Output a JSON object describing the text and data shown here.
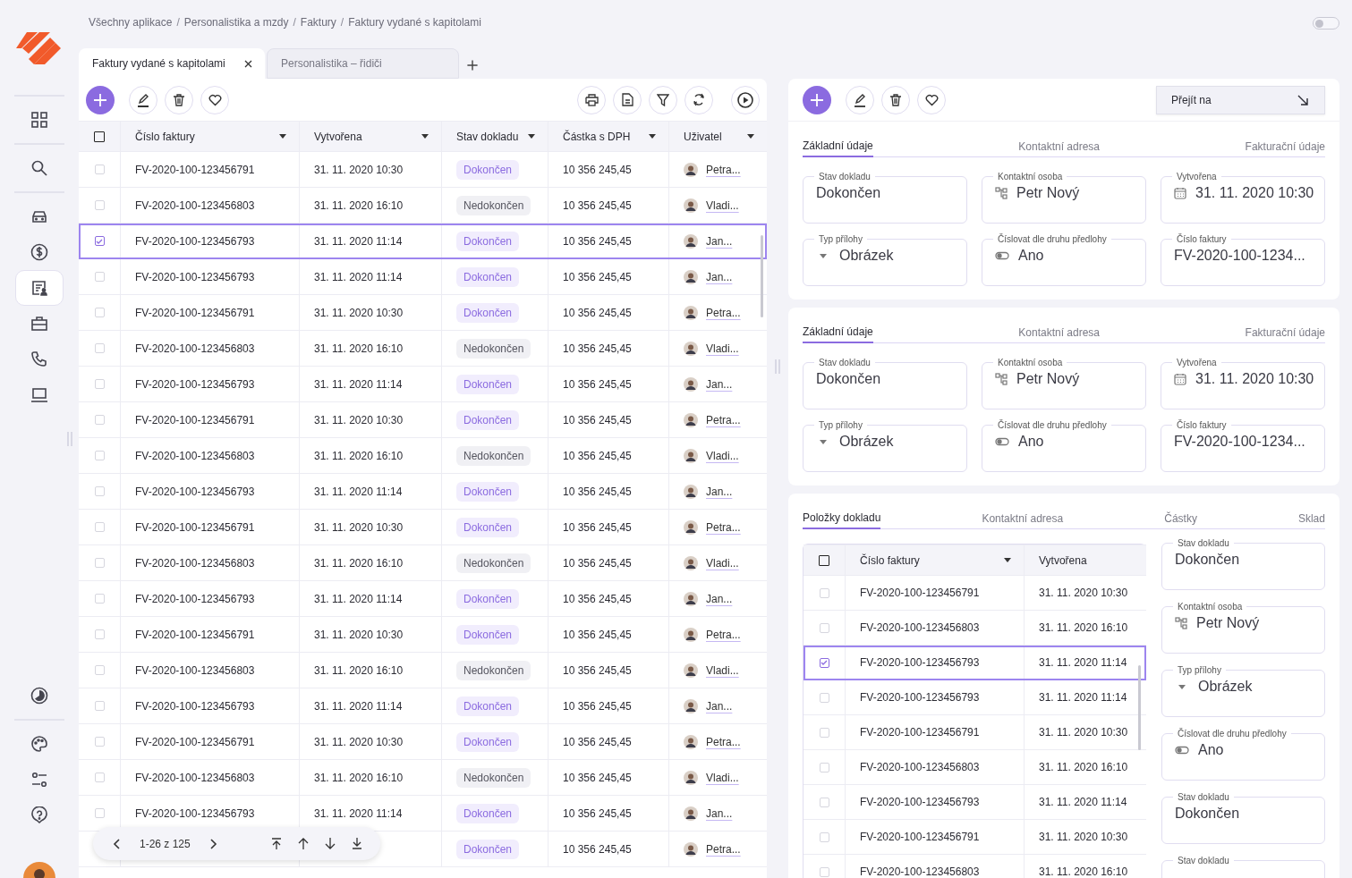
{
  "breadcrumb": [
    "Všechny aplikace",
    "Personalistika a mzdy",
    "Faktury",
    "Faktury vydané s kapitolami"
  ],
  "breadcrumb_separator": "/",
  "theme_switch": {
    "on": false
  },
  "nav_items": [
    {
      "selected": false
    },
    {
      "selected": false
    },
    {
      "selected": true
    },
    {
      "selected": false
    },
    {
      "selected": false
    },
    {
      "selected": false
    }
  ],
  "tabs": [
    {
      "label": "Faktury vydané s kapitolami",
      "selected": true,
      "closable": true
    },
    {
      "label": "Personalistika – řidiči",
      "selected": false,
      "closable": false
    }
  ],
  "table": {
    "all_selected": false,
    "columns": [
      "Číslo faktury",
      "Vytvořena",
      "Stav dokladu",
      "Částka s DPH",
      "Uživatel"
    ],
    "rows": [
      {
        "selected": false,
        "invoice": "FV-2020-100-123456791",
        "created": "31. 11. 2020 10:30",
        "status": "Dokončen",
        "complete": true,
        "amount": "10 356 245,45",
        "user": "Petra..."
      },
      {
        "selected": false,
        "invoice": "FV-2020-100-123456803",
        "created": "31. 11. 2020 16:10",
        "status": "Nedokončen",
        "complete": false,
        "amount": "10 356 245,45",
        "user": "Vladi..."
      },
      {
        "selected": true,
        "invoice": "FV-2020-100-123456793",
        "created": "31. 11. 2020 11:14",
        "status": "Dokončen",
        "complete": true,
        "amount": "10 356 245,45",
        "user": "Jan..."
      },
      {
        "selected": false,
        "invoice": "FV-2020-100-123456793",
        "created": "31. 11. 2020 11:14",
        "status": "Dokončen",
        "complete": true,
        "amount": "10 356 245,45",
        "user": "Jan..."
      },
      {
        "selected": false,
        "invoice": "FV-2020-100-123456791",
        "created": "31. 11. 2020 10:30",
        "status": "Dokončen",
        "complete": true,
        "amount": "10 356 245,45",
        "user": "Petra..."
      },
      {
        "selected": false,
        "invoice": "FV-2020-100-123456803",
        "created": "31. 11. 2020 16:10",
        "status": "Nedokončen",
        "complete": false,
        "amount": "10 356 245,45",
        "user": "Vladi..."
      },
      {
        "selected": false,
        "invoice": "FV-2020-100-123456793",
        "created": "31. 11. 2020 11:14",
        "status": "Dokončen",
        "complete": true,
        "amount": "10 356 245,45",
        "user": "Jan..."
      },
      {
        "selected": false,
        "invoice": "FV-2020-100-123456791",
        "created": "31. 11. 2020 10:30",
        "status": "Dokončen",
        "complete": true,
        "amount": "10 356 245,45",
        "user": "Petra..."
      },
      {
        "selected": false,
        "invoice": "FV-2020-100-123456803",
        "created": "31. 11. 2020 16:10",
        "status": "Nedokončen",
        "complete": false,
        "amount": "10 356 245,45",
        "user": "Vladi..."
      },
      {
        "selected": false,
        "invoice": "FV-2020-100-123456793",
        "created": "31. 11. 2020 11:14",
        "status": "Dokončen",
        "complete": true,
        "amount": "10 356 245,45",
        "user": "Jan..."
      },
      {
        "selected": false,
        "invoice": "FV-2020-100-123456791",
        "created": "31. 11. 2020 10:30",
        "status": "Dokončen",
        "complete": true,
        "amount": "10 356 245,45",
        "user": "Petra..."
      },
      {
        "selected": false,
        "invoice": "FV-2020-100-123456803",
        "created": "31. 11. 2020 16:10",
        "status": "Nedokončen",
        "complete": false,
        "amount": "10 356 245,45",
        "user": "Vladi..."
      },
      {
        "selected": false,
        "invoice": "FV-2020-100-123456793",
        "created": "31. 11. 2020 11:14",
        "status": "Dokončen",
        "complete": true,
        "amount": "10 356 245,45",
        "user": "Jan..."
      },
      {
        "selected": false,
        "invoice": "FV-2020-100-123456791",
        "created": "31. 11. 2020 10:30",
        "status": "Dokončen",
        "complete": true,
        "amount": "10 356 245,45",
        "user": "Petra..."
      },
      {
        "selected": false,
        "invoice": "FV-2020-100-123456803",
        "created": "31. 11. 2020 16:10",
        "status": "Nedokončen",
        "complete": false,
        "amount": "10 356 245,45",
        "user": "Vladi..."
      },
      {
        "selected": false,
        "invoice": "FV-2020-100-123456793",
        "created": "31. 11. 2020 11:14",
        "status": "Dokončen",
        "complete": true,
        "amount": "10 356 245,45",
        "user": "Jan..."
      },
      {
        "selected": false,
        "invoice": "FV-2020-100-123456791",
        "created": "31. 11. 2020 10:30",
        "status": "Dokončen",
        "complete": true,
        "amount": "10 356 245,45",
        "user": "Petra..."
      },
      {
        "selected": false,
        "invoice": "FV-2020-100-123456803",
        "created": "31. 11. 2020 16:10",
        "status": "Nedokončen",
        "complete": false,
        "amount": "10 356 245,45",
        "user": "Vladi..."
      },
      {
        "selected": false,
        "invoice": "FV-2020-100-123456793",
        "created": "31. 11. 2020 11:14",
        "status": "Dokončen",
        "complete": true,
        "amount": "10 356 245,45",
        "user": "Jan..."
      },
      {
        "status": "Dokončen",
        "complete": true,
        "amount": "10 356 245,45",
        "user": "Petra..."
      }
    ]
  },
  "pagination": {
    "range": "1-26 z 125"
  },
  "goto_button": "Přejít na",
  "forms": [
    {
      "tabs": [
        {
          "label": "Základní údaje",
          "selected": true
        },
        {
          "label": "Kontaktní adresa",
          "selected": false
        },
        {
          "label": "Fakturační údaje",
          "selected": false
        }
      ],
      "fields": [
        {
          "kind": "text",
          "label": "Stav dokladu",
          "value": "Dokončen"
        },
        {
          "kind": "person",
          "label": "Kontaktní osoba",
          "value": "Petr Nový"
        },
        {
          "kind": "date",
          "label": "Vytvořena",
          "value": "31. 11. 2020 10:30"
        },
        {
          "kind": "select",
          "label": "Typ přílohy",
          "value": "Obrázek"
        },
        {
          "kind": "toggle",
          "label": "Číslovat dle druhu předlohy",
          "value": "Ano"
        },
        {
          "kind": "text",
          "label": "Číslo faktury",
          "value": "FV-2020-100-1234..."
        }
      ]
    },
    {
      "tabs": [
        {
          "label": "Základní údaje",
          "selected": true
        },
        {
          "label": "Kontaktní adresa",
          "selected": false
        },
        {
          "label": "Fakturační údaje",
          "selected": false
        }
      ],
      "fields": [
        {
          "kind": "text",
          "label": "Stav dokladu",
          "value": "Dokončen"
        },
        {
          "kind": "person",
          "label": "Kontaktní osoba",
          "value": "Petr Nový"
        },
        {
          "kind": "date",
          "label": "Vytvořena",
          "value": "31. 11. 2020 10:30"
        },
        {
          "kind": "select",
          "label": "Typ přílohy",
          "value": "Obrázek"
        },
        {
          "kind": "toggle",
          "label": "Číslovat dle druhu předlohy",
          "value": "Ano"
        },
        {
          "kind": "text",
          "label": "Číslo faktury",
          "value": "FV-2020-100-1234..."
        }
      ]
    }
  ],
  "items_panel": {
    "tabs": [
      {
        "label": "Položky dokladu",
        "selected": true
      },
      {
        "label": "Kontaktní adresa",
        "selected": false
      },
      {
        "label": "Částky",
        "selected": false
      },
      {
        "label": "Sklad",
        "selected": false
      }
    ],
    "all_selected": false,
    "columns": [
      "Číslo faktury",
      "Vytvořena"
    ],
    "rows": [
      {
        "selected": false,
        "invoice": "FV-2020-100-123456791",
        "created": "31. 11. 2020 10:30"
      },
      {
        "selected": false,
        "invoice": "FV-2020-100-123456803",
        "created": "31. 11. 2020 16:10"
      },
      {
        "selected": true,
        "invoice": "FV-2020-100-123456793",
        "created": "31. 11. 2020 11:14"
      },
      {
        "selected": false,
        "invoice": "FV-2020-100-123456793",
        "created": "31. 11. 2020 11:14"
      },
      {
        "selected": false,
        "invoice": "FV-2020-100-123456791",
        "created": "31. 11. 2020 10:30"
      },
      {
        "selected": false,
        "invoice": "FV-2020-100-123456803",
        "created": "31. 11. 2020 16:10"
      },
      {
        "selected": false,
        "invoice": "FV-2020-100-123456793",
        "created": "31. 11. 2020 11:14"
      },
      {
        "selected": false,
        "invoice": "FV-2020-100-123456791",
        "created": "31. 11. 2020 10:30"
      },
      {
        "selected": false,
        "invoice": "FV-2020-100-123456803",
        "created": "31. 11. 2020 16:10"
      }
    ],
    "fields": [
      {
        "kind": "text",
        "label": "Stav dokladu",
        "value": "Dokončen"
      },
      {
        "kind": "person",
        "label": "Kontaktní osoba",
        "value": "Petr Nový"
      },
      {
        "kind": "select",
        "label": "Typ přílohy",
        "value": "Obrázek"
      },
      {
        "kind": "toggle",
        "label": "Číslovat dle druhu předlohy",
        "value": "Ano"
      },
      {
        "kind": "text",
        "label": "Stav dokladu",
        "value": "Dokončen"
      },
      {
        "label": "Stav dokladu"
      }
    ]
  }
}
